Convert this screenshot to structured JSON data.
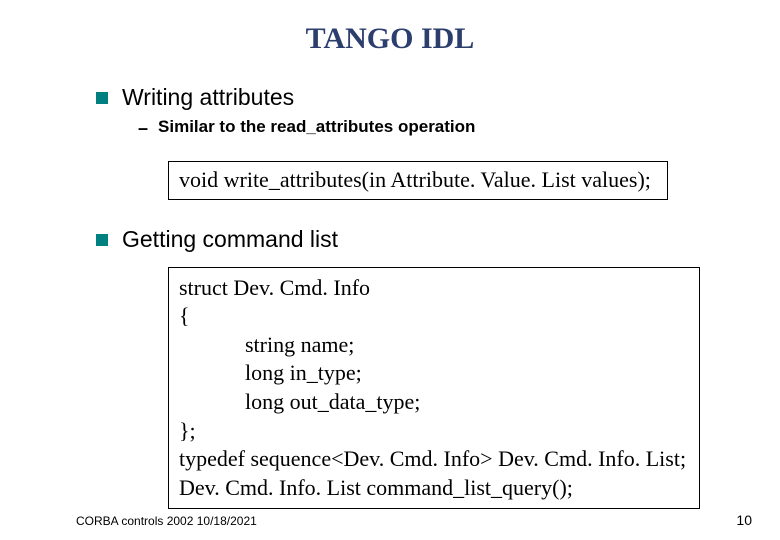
{
  "title": "TANGO IDL",
  "item1": {
    "text": "Writing attributes",
    "sub": "Similar to the read_attributes operation"
  },
  "code1": {
    "line1": "void write_attributes(in Attribute. Value. List values);"
  },
  "item2": {
    "text": "Getting command list"
  },
  "code2": {
    "l1": "struct Dev. Cmd. Info",
    "l2": "{",
    "l3": "            string name;",
    "l4": "            long in_type;",
    "l5": "            long out_data_type;",
    "l6": "};",
    "l7": "typedef sequence<Dev. Cmd. Info> Dev. Cmd. Info. List;",
    "l8": "Dev. Cmd. Info. List command_list_query();"
  },
  "footer": {
    "left": "CORBA controls 2002  10/18/2021",
    "right": "10"
  }
}
